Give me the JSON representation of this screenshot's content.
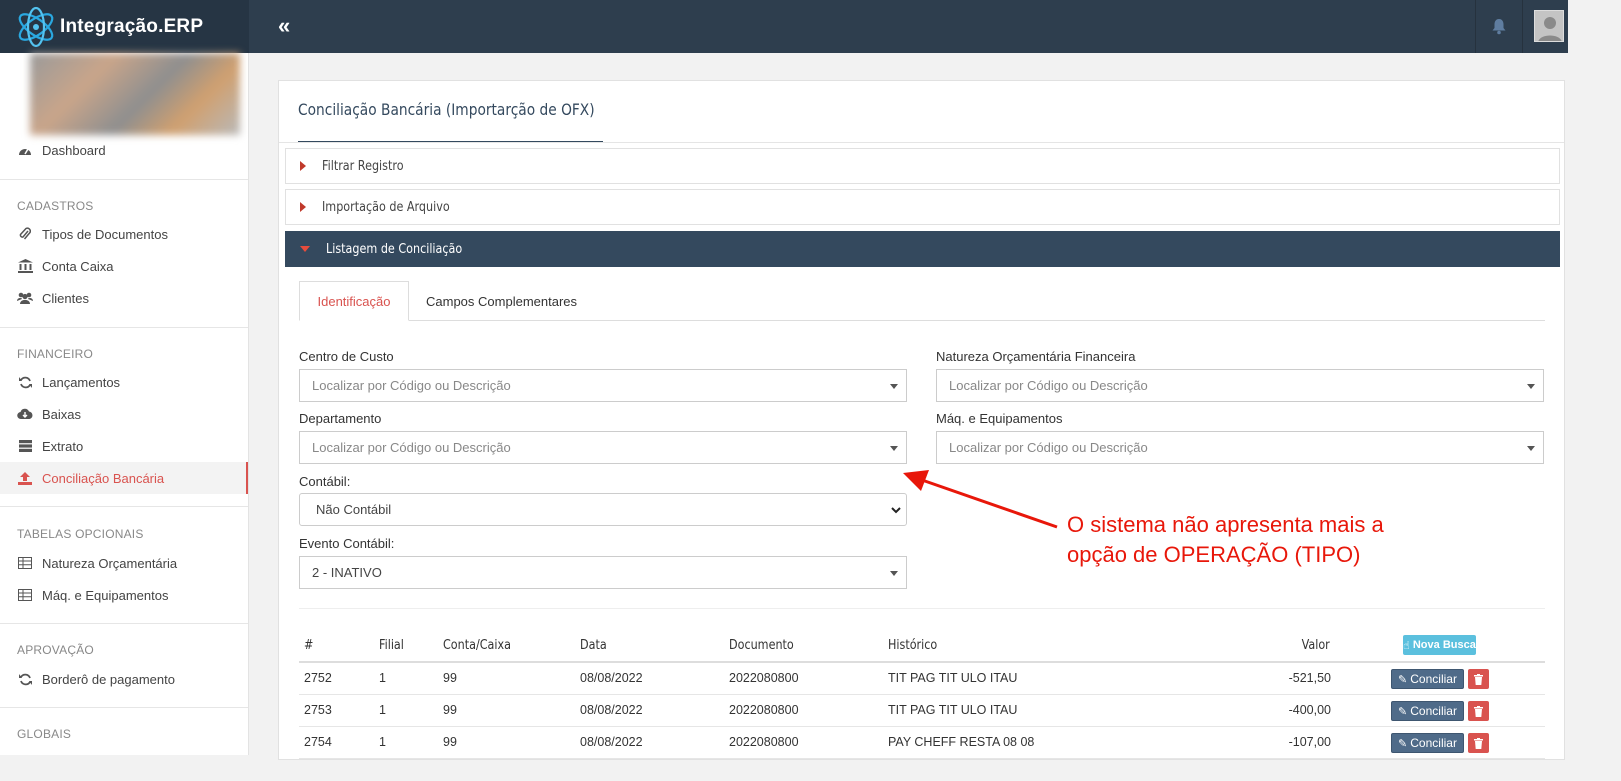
{
  "header": {
    "brand": "Integração.ERP"
  },
  "sidebar": {
    "sections": [
      "CADASTROS",
      "FINANCEIRO",
      "TABELAS OPCIONAIS",
      "APROVAÇÃO",
      "GLOBAIS"
    ],
    "dashboard": "Dashboard",
    "cadastros": [
      "Tipos de Documentos",
      "Conta Caixa",
      "Clientes"
    ],
    "financeiro": [
      "Lançamentos",
      "Baixas",
      "Extrato",
      "Conciliação Bancária"
    ],
    "tabelas": [
      "Natureza Orçamentária",
      "Máq. e Equipamentos"
    ],
    "aprovacao": [
      "Borderô de pagamento"
    ]
  },
  "page": {
    "title": "Conciliação Bancária (Importarção de OFX)",
    "accordions": [
      "Filtrar Registro",
      "Importação de Arquivo",
      "Listagem de Conciliação"
    ],
    "tabs": [
      "Identificação",
      "Campos Complementares"
    ]
  },
  "form": {
    "centro_label": "Centro de Custo",
    "natureza_label": "Natureza Orçamentária Financeira",
    "departamento_label": "Departamento",
    "maq_label": "Máq. e Equipamentos",
    "contabil_label": "Contábil:",
    "evento_label": "Evento Contábil:",
    "placeholder": "Localizar por Código ou Descrição",
    "contabil_value": "Não Contábil",
    "evento_value": "2 - INATIVO"
  },
  "table": {
    "headers": [
      "#",
      "Filial",
      "Conta/Caixa",
      "Data",
      "Documento",
      "Histórico",
      "Valor"
    ],
    "nova_busca": "Nova Busca",
    "conciliar": "Conciliar",
    "rows": [
      [
        "2752",
        "1",
        "99",
        "08/08/2022",
        "2022080800",
        "TIT PAG TIT ULO ITAU",
        "-521,50"
      ],
      [
        "2753",
        "1",
        "99",
        "08/08/2022",
        "2022080800",
        "TIT PAG TIT ULO ITAU",
        "-400,00"
      ],
      [
        "2754",
        "1",
        "99",
        "08/08/2022",
        "2022080800",
        "PAY CHEFF RESTA 08 08",
        "-107,00"
      ]
    ]
  },
  "annotation": {
    "line1": "O sistema não apresenta mais a",
    "line2": "opção de OPERAÇÃO (TIPO)",
    "color": "#e8170a"
  }
}
